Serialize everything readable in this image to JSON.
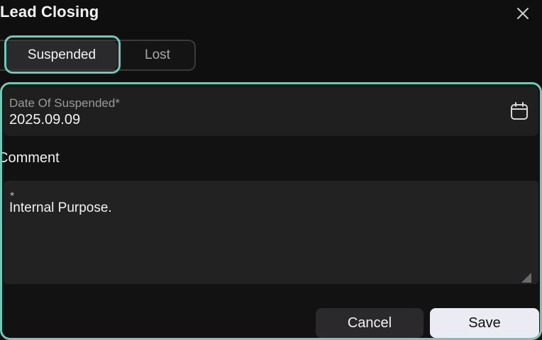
{
  "dialog": {
    "title": "Lead Closing",
    "close_icon": "close-icon"
  },
  "tabs": [
    {
      "label": "Suspended",
      "selected": true
    },
    {
      "label": "Lost",
      "selected": false
    }
  ],
  "date_field": {
    "label": "Date Of Suspended*",
    "value": "2025.09.09",
    "icon": "calendar-icon"
  },
  "comment": {
    "heading": "Comment",
    "required_mark": "*",
    "value": "Internal Purpose."
  },
  "actions": {
    "cancel_label": "Cancel",
    "save_label": "Save"
  },
  "colors": {
    "focus_ring": "#6fc9b8",
    "background": "#0f0f10",
    "field_bg": "#1f1f20",
    "save_bg": "#ebebf3"
  }
}
